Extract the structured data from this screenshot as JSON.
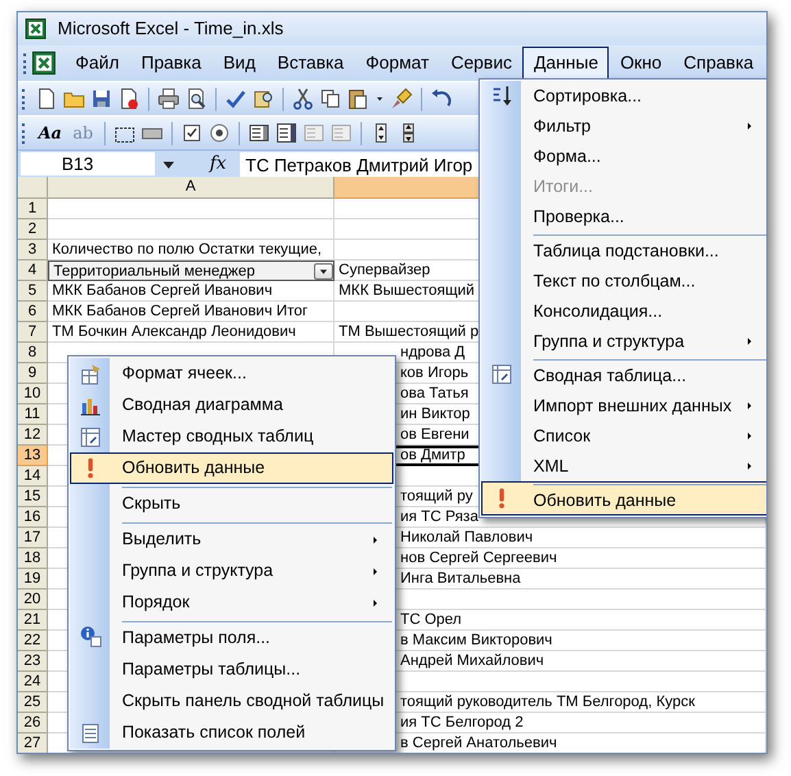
{
  "window": {
    "title": "Microsoft Excel - Time_in.xls"
  },
  "menu_bar": [
    {
      "label": "Файл",
      "selected": false
    },
    {
      "label": "Правка",
      "selected": false
    },
    {
      "label": "Вид",
      "selected": false
    },
    {
      "label": "Вставка",
      "selected": false
    },
    {
      "label": "Формат",
      "selected": false
    },
    {
      "label": "Сервис",
      "selected": false
    },
    {
      "label": "Данные",
      "selected": true
    },
    {
      "label": "Окно",
      "selected": false
    },
    {
      "label": "Справка",
      "selected": false
    }
  ],
  "forms_toolbar": {
    "labels": [
      "Aa",
      "ab"
    ]
  },
  "formula_bar": {
    "name_box": "B13",
    "fx": "fx",
    "value": "ТС Петраков Дмитрий Игор"
  },
  "sheet": {
    "columns": [
      {
        "label": "A",
        "selected": false
      },
      {
        "selected": true
      }
    ],
    "rows": [
      {
        "number": "1",
        "selected": false
      },
      {
        "number": "2",
        "selected": false
      },
      {
        "number": "3",
        "selected": false,
        "column_a": "Количество по полю Остатки текущие,"
      },
      {
        "number": "4",
        "selected": false,
        "column_a": "Территориальный менеджер",
        "column_b": "Супервайзер",
        "kind": "field_header"
      },
      {
        "number": "5",
        "selected": false,
        "column_a": "МКК Бабанов Сергей Иванович",
        "column_b": "МКК Вышестоящий"
      },
      {
        "number": "6",
        "selected": false,
        "column_a": "МКК Бабанов Сергей Иванович Итог"
      },
      {
        "number": "7",
        "selected": false,
        "column_a": "ТМ Бочкин Александр Леонидович",
        "column_b": "ТМ Вышестоящий р"
      },
      {
        "number": "8",
        "selected": false,
        "column_b": "ндрова Д"
      },
      {
        "number": "9",
        "selected": false,
        "column_b": "ков Игорь"
      },
      {
        "number": "10",
        "selected": false,
        "column_b": "ова Татья"
      },
      {
        "number": "11",
        "selected": false,
        "column_b": "ин Виктор"
      },
      {
        "number": "12",
        "selected": false,
        "column_b": "ов Евгени"
      },
      {
        "number": "13",
        "selected": true,
        "column_b": "ов Дмитр"
      },
      {
        "number": "14",
        "selected": false
      },
      {
        "number": "15",
        "selected": false,
        "column_b": "тоящий ру"
      },
      {
        "number": "16",
        "selected": false,
        "column_b": "ия ТС Ряза"
      },
      {
        "number": "17",
        "selected": false,
        "column_b": "Николай Павлович"
      },
      {
        "number": "18",
        "selected": false,
        "column_b": "нов Сергей Сергеевич"
      },
      {
        "number": "19",
        "selected": false,
        "column_b": "Инга Витальевна"
      },
      {
        "number": "20",
        "selected": false
      },
      {
        "number": "21",
        "selected": false,
        "column_b": "ТС Орел"
      },
      {
        "number": "22",
        "selected": false,
        "column_b": "в Максим Викторович"
      },
      {
        "number": "23",
        "selected": false,
        "column_b": "Андрей Михайлович"
      },
      {
        "number": "24",
        "selected": false
      },
      {
        "number": "25",
        "selected": false,
        "column_b": "тоящий руководитель ТМ Белгород, Курск"
      },
      {
        "number": "26",
        "selected": false,
        "column_b": "ия ТС Белгород 2"
      },
      {
        "number": "27",
        "selected": false,
        "column_b": "в Сергей Анатольевич"
      }
    ]
  },
  "data_menu": [
    {
      "label": "Сортировка...",
      "disabled": false,
      "submenu": false,
      "group_start": false,
      "selected": false
    },
    {
      "label": "Фильтр",
      "disabled": false,
      "submenu": true,
      "group_start": false,
      "selected": false
    },
    {
      "label": "Форма...",
      "disabled": false,
      "submenu": false,
      "group_start": false,
      "selected": false
    },
    {
      "label": "Итоги...",
      "disabled": true,
      "submenu": false,
      "group_start": false,
      "selected": false
    },
    {
      "label": "Проверка...",
      "disabled": false,
      "submenu": false,
      "group_start": false,
      "selected": false
    },
    {
      "label": "Таблица подстановки...",
      "disabled": false,
      "submenu": false,
      "group_start": true,
      "selected": false
    },
    {
      "label": "Текст по столбцам...",
      "disabled": false,
      "submenu": false,
      "group_start": false,
      "selected": false
    },
    {
      "label": "Консолидация...",
      "disabled": false,
      "submenu": false,
      "group_start": false,
      "selected": false
    },
    {
      "label": "Группа и структура",
      "disabled": false,
      "submenu": true,
      "group_start": false,
      "selected": false
    },
    {
      "label": "Сводная таблица...",
      "disabled": false,
      "submenu": false,
      "group_start": true,
      "selected": false
    },
    {
      "label": "Импорт внешних данных",
      "disabled": false,
      "submenu": true,
      "group_start": false,
      "selected": false
    },
    {
      "label": "Список",
      "disabled": false,
      "submenu": true,
      "group_start": false,
      "selected": false
    },
    {
      "label": "XML",
      "disabled": false,
      "submenu": true,
      "group_start": false,
      "selected": false
    },
    {
      "label": "Обновить данные",
      "disabled": false,
      "submenu": false,
      "group_start": true,
      "selected": true
    }
  ],
  "context_menu": [
    {
      "label": "Формат ячеек...",
      "submenu": false,
      "group_start": false,
      "selected": false
    },
    {
      "label": "Сводная диаграмма",
      "submenu": false,
      "group_start": false,
      "selected": false
    },
    {
      "label": "Мастер сводных таблиц",
      "submenu": false,
      "group_start": false,
      "selected": false
    },
    {
      "label": "Обновить данные",
      "submenu": false,
      "group_start": false,
      "selected": true
    },
    {
      "label": "Скрыть",
      "submenu": false,
      "group_start": true,
      "selected": false
    },
    {
      "label": "Выделить",
      "submenu": true,
      "group_start": true,
      "selected": false
    },
    {
      "label": "Группа и структура",
      "submenu": true,
      "group_start": false,
      "selected": false
    },
    {
      "label": "Порядок",
      "submenu": true,
      "group_start": false,
      "selected": false
    },
    {
      "label": "Параметры поля...",
      "submenu": false,
      "group_start": true,
      "selected": false
    },
    {
      "label": "Параметры таблицы...",
      "submenu": false,
      "group_start": false,
      "selected": false
    },
    {
      "label": "Скрыть панель сводной таблицы",
      "submenu": false,
      "group_start": false,
      "selected": false
    },
    {
      "label": "Показать список полей",
      "submenu": false,
      "group_start": false,
      "selected": false
    }
  ]
}
